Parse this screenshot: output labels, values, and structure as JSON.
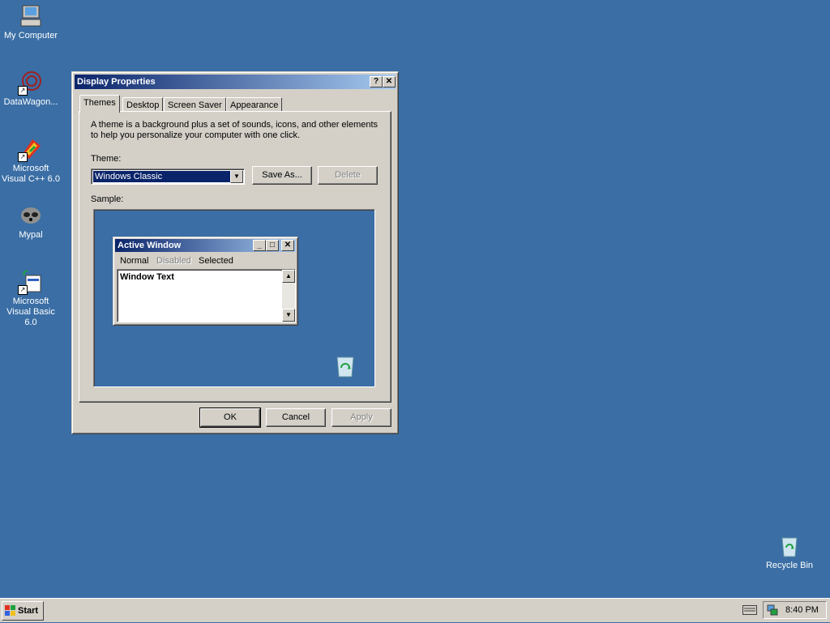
{
  "desktop": {
    "icons": [
      {
        "label": "My Computer",
        "icon": "computer-icon"
      },
      {
        "label": "DataWagon...",
        "icon": "datawagon-icon"
      },
      {
        "label": "Microsoft Visual C++ 6.0",
        "icon": "visual-cpp-icon"
      },
      {
        "label": "Mypal",
        "icon": "mypal-icon"
      },
      {
        "label": "Microsoft Visual Basic 6.0",
        "icon": "visual-basic-icon"
      },
      {
        "label": "Recycle Bin",
        "icon": "recycle-bin-icon"
      }
    ],
    "background_color": "#3a6ea5"
  },
  "dialog": {
    "title": "Display Properties",
    "help_btn": "?",
    "close_btn": "✕",
    "tabs": [
      "Themes",
      "Desktop",
      "Screen Saver",
      "Appearance"
    ],
    "description": "A theme is a background plus a set of sounds, icons, and other elements to help you personalize your computer with one click.",
    "theme_label": "Theme:",
    "theme_value": "Windows Classic",
    "save_as": "Save As...",
    "delete": "Delete",
    "sample_label": "Sample:",
    "ok": "OK",
    "cancel": "Cancel",
    "apply": "Apply"
  },
  "sample": {
    "window_title": "Active Window",
    "menu_normal": "Normal",
    "menu_disabled": "Disabled",
    "menu_selected": "Selected",
    "window_text": "Window Text"
  },
  "taskbar": {
    "start_label": "Start",
    "clock": "8:40 PM"
  },
  "colors": {
    "title_start": "#0a246a",
    "title_end": "#a6caf0",
    "face": "#d4d0c8",
    "selection": "#0a246a"
  }
}
